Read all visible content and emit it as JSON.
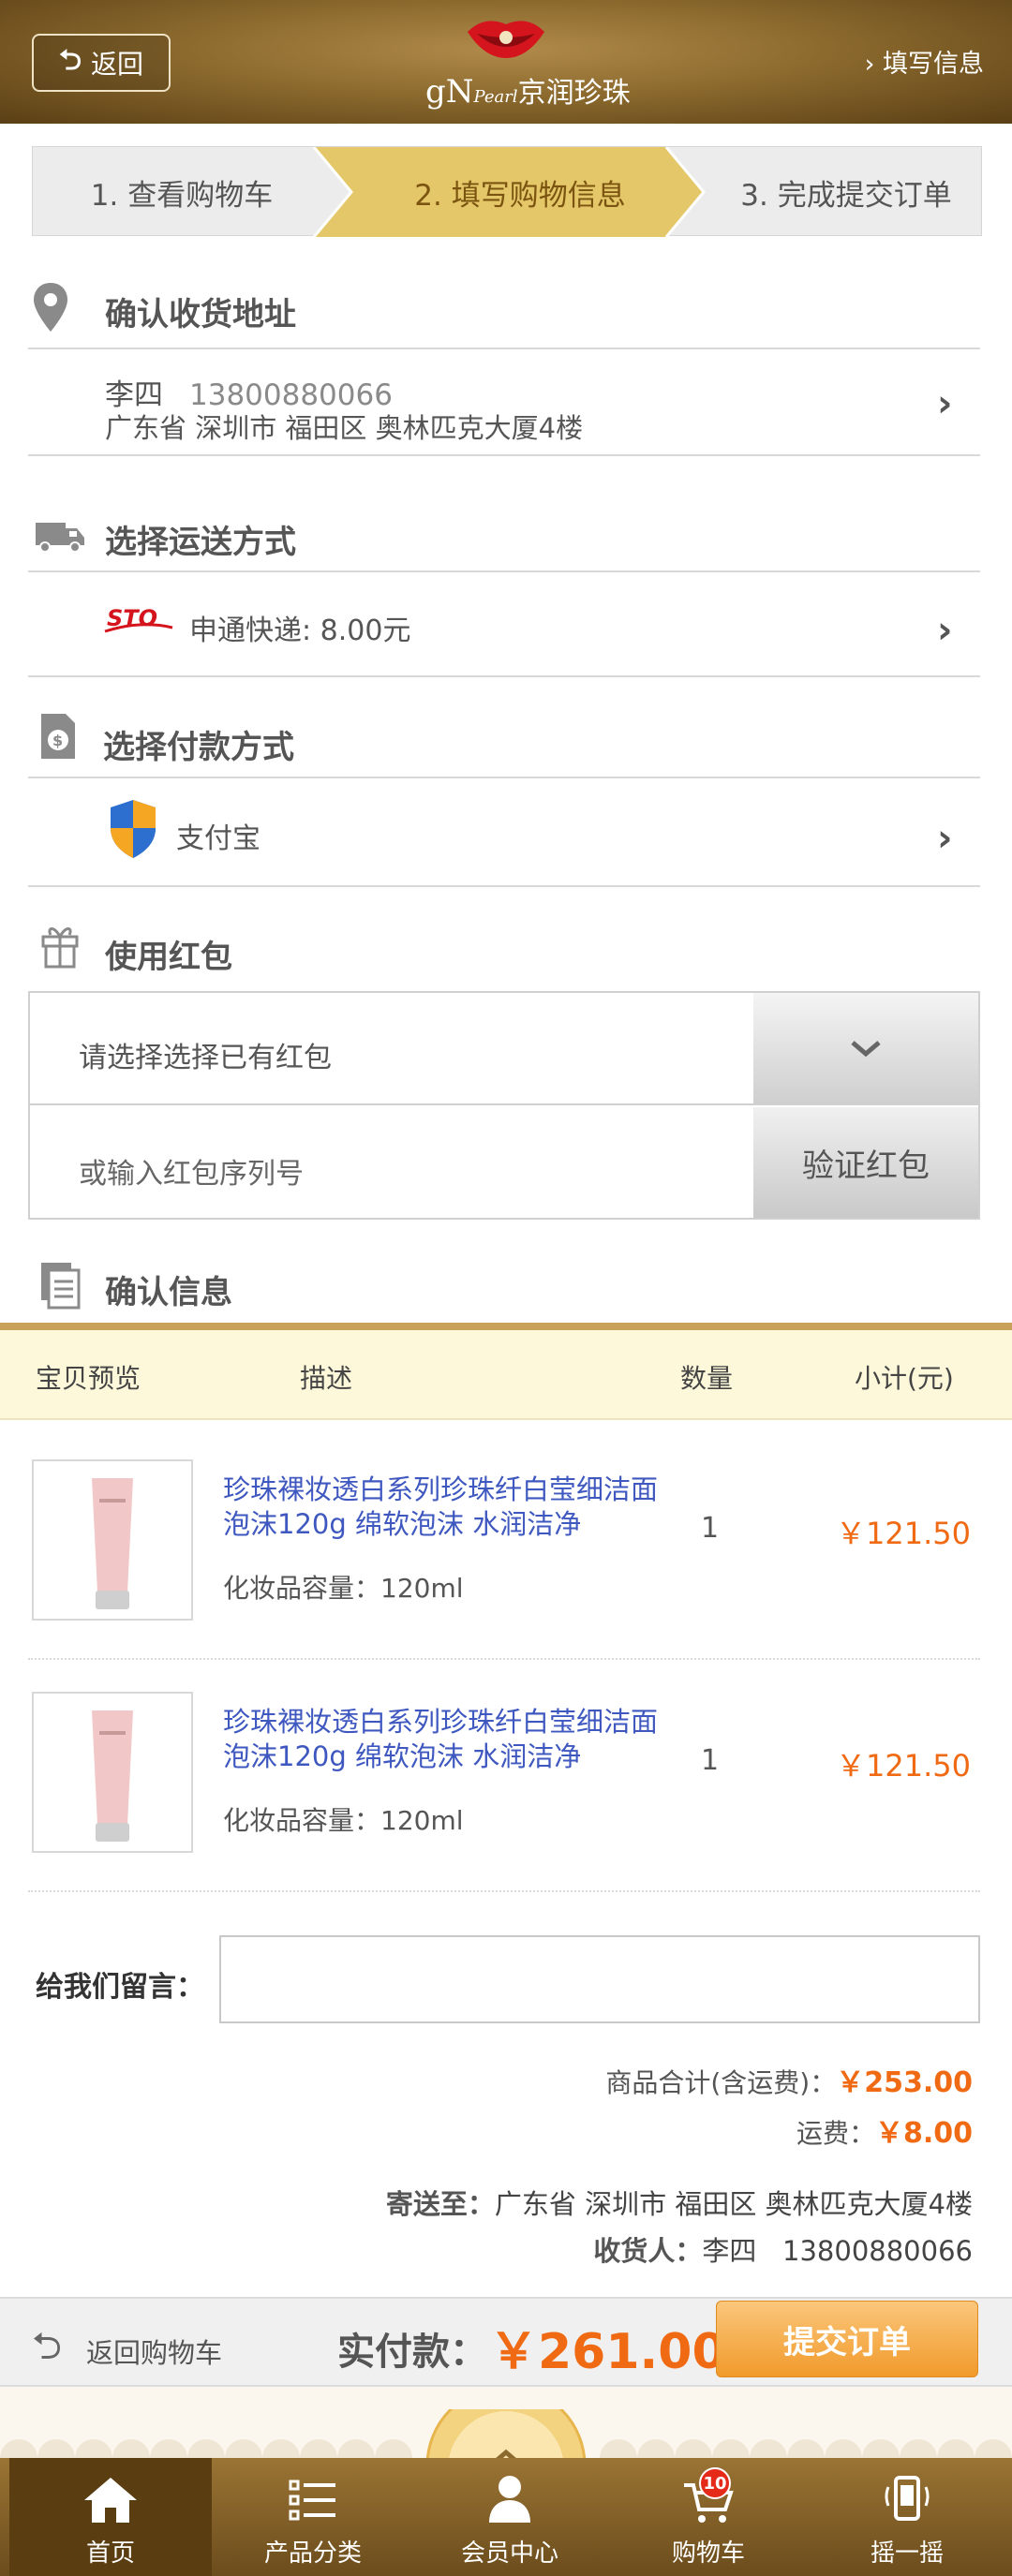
{
  "header": {
    "back_label": "返回",
    "logo_text": "京润珍珠",
    "logo_gn": "gN",
    "logo_pearl": "Pearl",
    "right_link": "填写信息"
  },
  "steps": [
    {
      "label": "1. 查看购物车"
    },
    {
      "label": "2. 填写购物信息",
      "active": true
    },
    {
      "label": "3. 完成提交订单"
    }
  ],
  "address": {
    "title": "确认收货地址",
    "name": "李四",
    "phone": "13800880066",
    "line": "广东省 深圳市 福田区 奥林匹克大厦4楼"
  },
  "shipping": {
    "title": "选择运送方式",
    "text": "申通快递: 8.00元",
    "logo": "STO"
  },
  "payment": {
    "title": "选择付款方式",
    "text": "支付宝"
  },
  "red_packet": {
    "title": "使用红包",
    "select_placeholder": "请选择选择已有红包",
    "input_placeholder": "或输入红包序列号",
    "verify_label": "验证红包"
  },
  "confirm": {
    "title": "确认信息",
    "columns": [
      "宝贝预览",
      "描述",
      "数量",
      "小计(元)"
    ],
    "products": [
      {
        "name": "珍珠裸妆透白系列珍珠纤白莹细洁面泡沫120g 绵软泡沫 水润洁净",
        "spec": "化妆品容量：120ml",
        "qty": "1",
        "price": "￥121.50"
      },
      {
        "name": "珍珠裸妆透白系列珍珠纤白莹细洁面泡沫120g 绵软泡沫 水润洁净",
        "spec": "化妆品容量：120ml",
        "qty": "1",
        "price": "￥121.50"
      }
    ],
    "message_label": "给我们留言："
  },
  "totals": {
    "goods_label": "商品合计(含运费)：",
    "goods_value": "￥253.00",
    "ship_label": "运费：",
    "ship_value": "￥8.00",
    "ship_to_label": "寄送至：",
    "ship_to_value": "广东省 深圳市 福田区 奥林匹克大厦4楼",
    "receiver_label": "收货人：",
    "receiver_value": "李四   13800880066"
  },
  "action": {
    "back_cart": "返回购物车",
    "pay_label": "实付款：",
    "pay_amount": "￥261.00",
    "submit": "提交订单"
  },
  "nav": {
    "home": "首页",
    "category": "产品分类",
    "member": "会员中心",
    "cart": "购物车",
    "cart_badge": "10",
    "shake": "摇一摇"
  },
  "colors": {
    "brand_brown": "#8c6a2e",
    "accent_orange": "#f06a14",
    "link_blue": "#3f58c0",
    "active_step": "#e4c768"
  }
}
